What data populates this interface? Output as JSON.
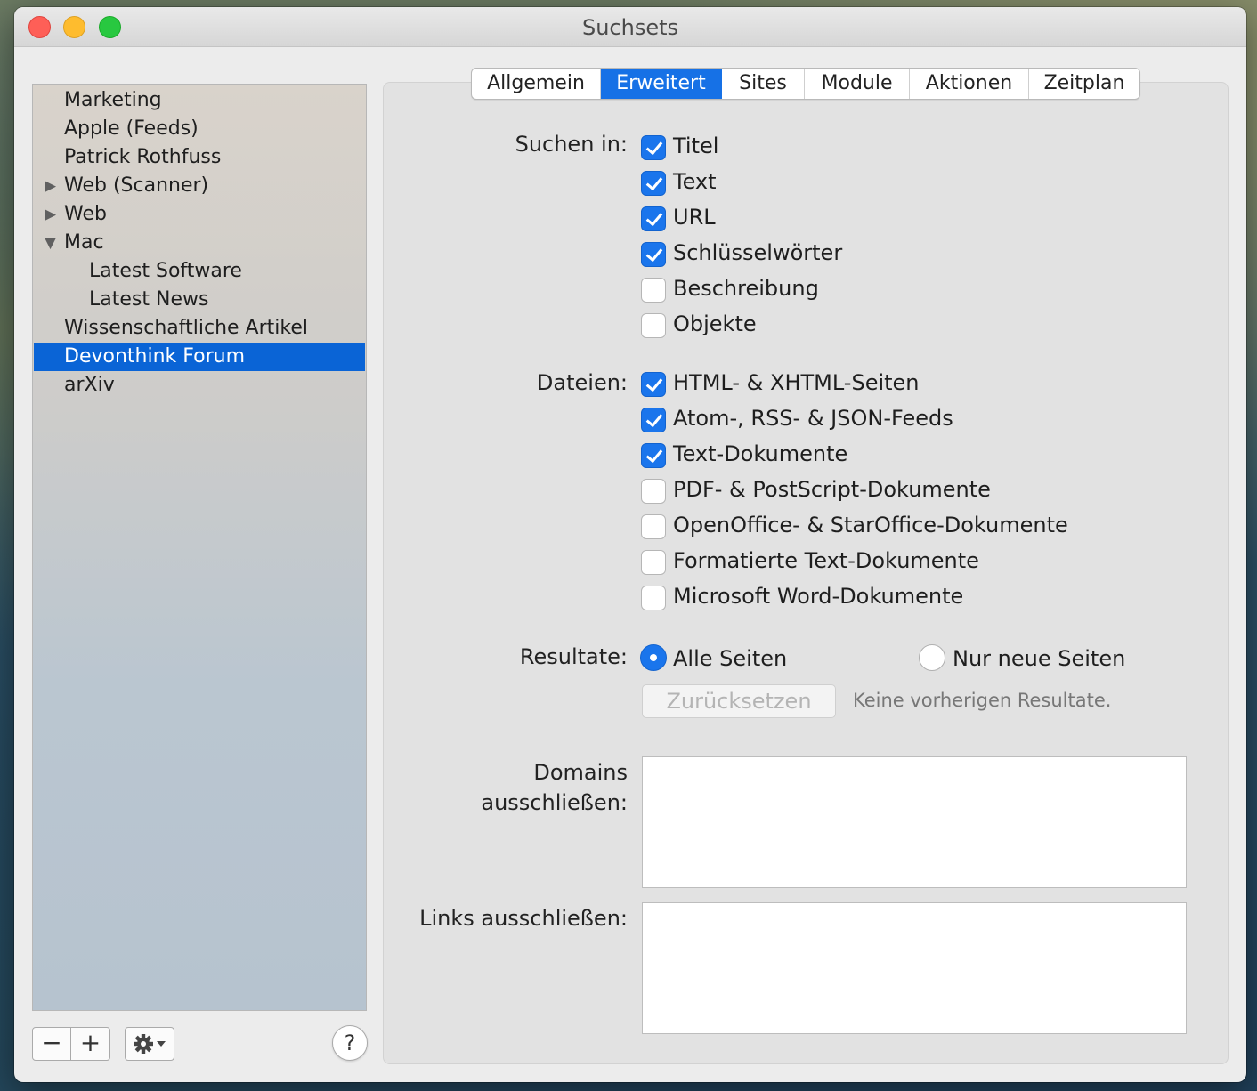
{
  "window": {
    "title": "Suchsets"
  },
  "sidebar": {
    "items": [
      {
        "label": "Marketing",
        "level": 0,
        "disclosure": ""
      },
      {
        "label": "Apple (Feeds)",
        "level": 0,
        "disclosure": ""
      },
      {
        "label": "Patrick Rothfuss",
        "level": 0,
        "disclosure": ""
      },
      {
        "label": "Web (Scanner)",
        "level": 0,
        "disclosure": "▶"
      },
      {
        "label": "Web",
        "level": 0,
        "disclosure": "▶"
      },
      {
        "label": "Mac",
        "level": 0,
        "disclosure": "▼"
      },
      {
        "label": "Latest Software",
        "level": 1,
        "disclosure": ""
      },
      {
        "label": "Latest News",
        "level": 1,
        "disclosure": ""
      },
      {
        "label": "Wissenschaftliche Artikel",
        "level": 0,
        "disclosure": ""
      },
      {
        "label": "Devonthink Forum",
        "level": 0,
        "disclosure": "",
        "selected": true
      },
      {
        "label": "arXiv",
        "level": 0,
        "disclosure": ""
      }
    ],
    "remove_label": "−",
    "add_label": "+",
    "actions_icon": "gear-icon",
    "help_label": "?"
  },
  "tabs": [
    {
      "label": "Allgemein",
      "active": false
    },
    {
      "label": "Erweitert",
      "active": true
    },
    {
      "label": "Sites",
      "active": false
    },
    {
      "label": "Module",
      "active": false
    },
    {
      "label": "Aktionen",
      "active": false
    },
    {
      "label": "Zeitplan",
      "active": false
    }
  ],
  "search_in": {
    "label": "Suchen in:",
    "options": [
      {
        "label": "Titel",
        "checked": true
      },
      {
        "label": "Text",
        "checked": true
      },
      {
        "label": "URL",
        "checked": true
      },
      {
        "label": "Schlüsselwörter",
        "checked": true
      },
      {
        "label": "Beschreibung",
        "checked": false
      },
      {
        "label": "Objekte",
        "checked": false
      }
    ]
  },
  "files": {
    "label": "Dateien:",
    "options": [
      {
        "label": "HTML- & XHTML-Seiten",
        "checked": true
      },
      {
        "label": "Atom-, RSS- & JSON-Feeds",
        "checked": true
      },
      {
        "label": "Text-Dokumente",
        "checked": true
      },
      {
        "label": "PDF- & PostScript-Dokumente",
        "checked": false
      },
      {
        "label": "OpenOffice- & StarOffice-Dokumente",
        "checked": false
      },
      {
        "label": "Formatierte Text-Dokumente",
        "checked": false
      },
      {
        "label": "Microsoft Word-Dokumente",
        "checked": false
      }
    ]
  },
  "results": {
    "label": "Resultate:",
    "option_all": "Alle Seiten",
    "option_new": "Nur neue Seiten",
    "selected": "all",
    "reset_label": "Zurücksetzen",
    "hint": "Keine vorherigen Resultate."
  },
  "exclude_domains": {
    "label_line1": "Domains",
    "label_line2": "ausschließen:",
    "value": ""
  },
  "exclude_links": {
    "label": "Links ausschließen:",
    "value": ""
  },
  "colors": {
    "accent": "#1a75ec",
    "selection": "#0a64d6"
  }
}
